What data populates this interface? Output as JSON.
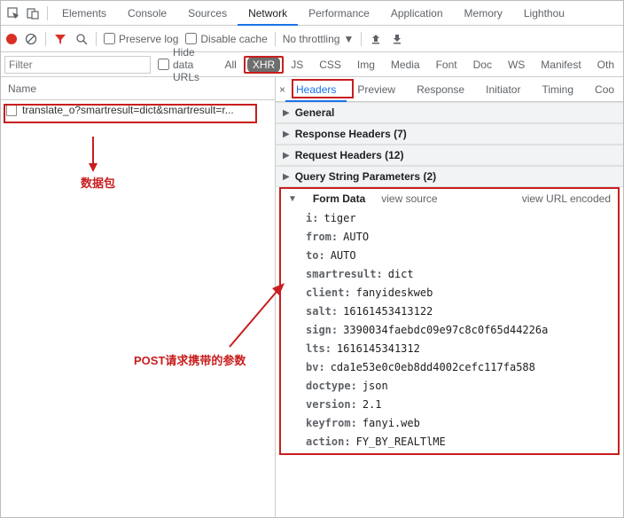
{
  "top_tabs": [
    "Elements",
    "Console",
    "Sources",
    "Network",
    "Performance",
    "Application",
    "Memory",
    "Lighthou"
  ],
  "top_tabs_active_index": 3,
  "toolbar": {
    "preserve_log": "Preserve log",
    "disable_cache": "Disable cache",
    "throttling": "No throttling"
  },
  "filter": {
    "placeholder": "Filter",
    "hide_data_urls": "Hide data URLs",
    "types": [
      "All",
      "XHR",
      "JS",
      "CSS",
      "Img",
      "Media",
      "Font",
      "Doc",
      "WS",
      "Manifest",
      "Oth"
    ],
    "types_active_index": 1
  },
  "left": {
    "header": "Name",
    "request": "translate_o?smartresult=dict&smartresult=r..."
  },
  "right_tabs": [
    "Headers",
    "Preview",
    "Response",
    "Initiator",
    "Timing",
    "Coo"
  ],
  "right_tabs_active_index": 0,
  "sections": {
    "general": "General",
    "response_headers": "Response Headers",
    "response_headers_count": "(7)",
    "request_headers": "Request Headers",
    "request_headers_count": "(12)",
    "query_string": "Query String Parameters",
    "query_string_count": "(2)"
  },
  "form_data": {
    "title": "Form Data",
    "view_source": "view source",
    "view_url_encoded": "view URL encoded",
    "entries": [
      {
        "k": "i",
        "v": "tiger"
      },
      {
        "k": "from",
        "v": "AUTO"
      },
      {
        "k": "to",
        "v": "AUTO"
      },
      {
        "k": "smartresult",
        "v": "dict"
      },
      {
        "k": "client",
        "v": "fanyideskweb"
      },
      {
        "k": "salt",
        "v": "16161453413122"
      },
      {
        "k": "sign",
        "v": "3390034faebdc09e97c8c0f65d44226a"
      },
      {
        "k": "lts",
        "v": "1616145341312"
      },
      {
        "k": "bv",
        "v": "cda1e53e0c0eb8dd4002cefc117fa588"
      },
      {
        "k": "doctype",
        "v": "json"
      },
      {
        "k": "version",
        "v": "2.1"
      },
      {
        "k": "keyfrom",
        "v": "fanyi.web"
      },
      {
        "k": "action",
        "v": "FY_BY_REALTlME"
      }
    ]
  },
  "annotations": {
    "packet": "数据包",
    "post_params": "POST请求携带的参数"
  }
}
